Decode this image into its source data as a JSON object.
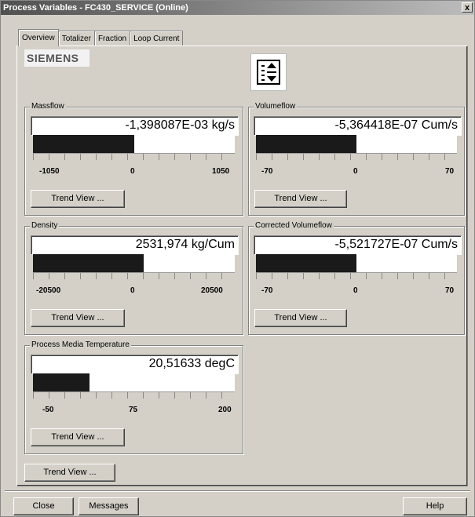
{
  "window": {
    "title": "Process Variables - FC430_SERVICE (Online)",
    "close_glyph": "x"
  },
  "tabs": [
    {
      "label": "Overview",
      "active": true
    },
    {
      "label": "Totalizer",
      "active": false
    },
    {
      "label": "Fraction",
      "active": false
    },
    {
      "label": "Loop Current",
      "active": false
    }
  ],
  "brand": {
    "logo_text": "SIEMENS",
    "device_icon": "flow-sensor-icon"
  },
  "panels": {
    "massflow": {
      "label": "Massflow",
      "value": "-1,398087E-03 kg/s",
      "scale": [
        "-1050",
        "0",
        "1050"
      ],
      "fill_fraction": 0.5,
      "button": "Trend View ..."
    },
    "volumeflow": {
      "label": "Volumeflow",
      "value": "-5,364418E-07 Cum/s",
      "scale": [
        "-70",
        "0",
        "70"
      ],
      "fill_fraction": 0.5,
      "button": "Trend View ..."
    },
    "density": {
      "label": "Density",
      "value": "2531,974 kg/Cum",
      "scale": [
        "-20500",
        "0",
        "20500"
      ],
      "fill_fraction": 0.55,
      "button": "Trend View ..."
    },
    "corrected_volumeflow": {
      "label": "Corrected Volumeflow",
      "value": "-5,521727E-07 Cum/s",
      "scale": [
        "-70",
        "0",
        "70"
      ],
      "fill_fraction": 0.5,
      "button": "Trend View ..."
    },
    "temperature": {
      "label": "Process Media Temperature",
      "value": "20,51633 degC",
      "scale": [
        "-50",
        "75",
        "200"
      ],
      "fill_fraction": 0.28,
      "button": "Trend View ..."
    }
  },
  "main_trend_button": "Trend View ...",
  "footer": {
    "close": "Close",
    "messages": "Messages",
    "help": "Help"
  },
  "colors": {
    "bar_fill": "#1a1a1a",
    "window_bg": "#d4d0c8"
  }
}
